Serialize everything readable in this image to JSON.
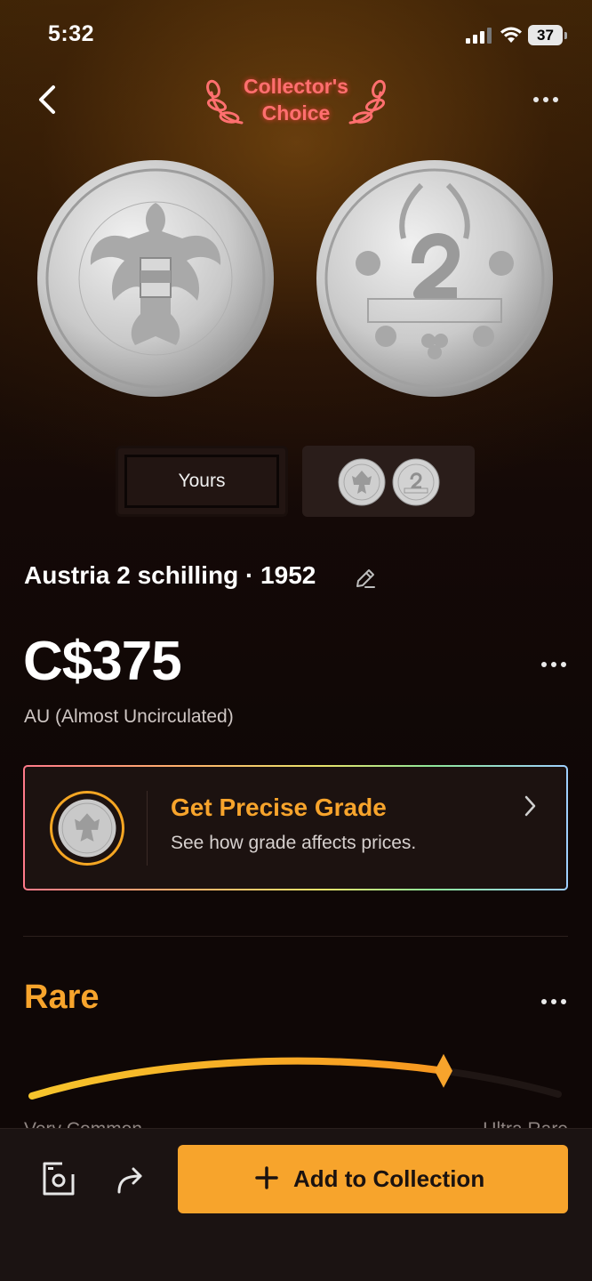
{
  "status_bar": {
    "time": "5:32",
    "battery": "37"
  },
  "header": {
    "back_icon": "chevron-left-icon",
    "badge_line1": "Collector's",
    "badge_line2": "Choice",
    "more_icon": "ellipsis-icon"
  },
  "images": {
    "front": "coin-obverse-eagle",
    "back": "coin-reverse-2-schilling"
  },
  "toggle": {
    "yours_label": "Yours",
    "reference": "reference-coin-thumbnails"
  },
  "coin": {
    "title": "Austria 2 schilling · 1952",
    "price": "C$375",
    "grade": "AU (Almost Uncirculated)"
  },
  "precise_grade": {
    "title": "Get Precise Grade",
    "subtitle": "See how grade affects prices."
  },
  "rarity": {
    "heading": "Rare",
    "left_label": "Very Common",
    "right_label": "Ultra Rare",
    "level": 0.78
  },
  "bottom_bar": {
    "add_label": "Add to Collection"
  },
  "colors": {
    "accent": "#f7a42c",
    "badge": "#ff6f6f"
  }
}
